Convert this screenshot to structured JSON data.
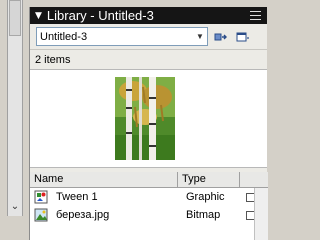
{
  "panel": {
    "title": "Library - Untitled-3",
    "document_select": "Untitled-3",
    "item_count": "2 items"
  },
  "columns": {
    "name": "Name",
    "type": "Type"
  },
  "items": [
    {
      "name": "Tween 1",
      "type": "Graphic",
      "icon": "graphic-symbol-icon"
    },
    {
      "name": "береза.jpg",
      "type": "Bitmap",
      "icon": "bitmap-icon"
    }
  ],
  "colors": {
    "titlebar": "#151515",
    "panel_bg": "#ecebe6",
    "list_bg": "#ffffff"
  }
}
